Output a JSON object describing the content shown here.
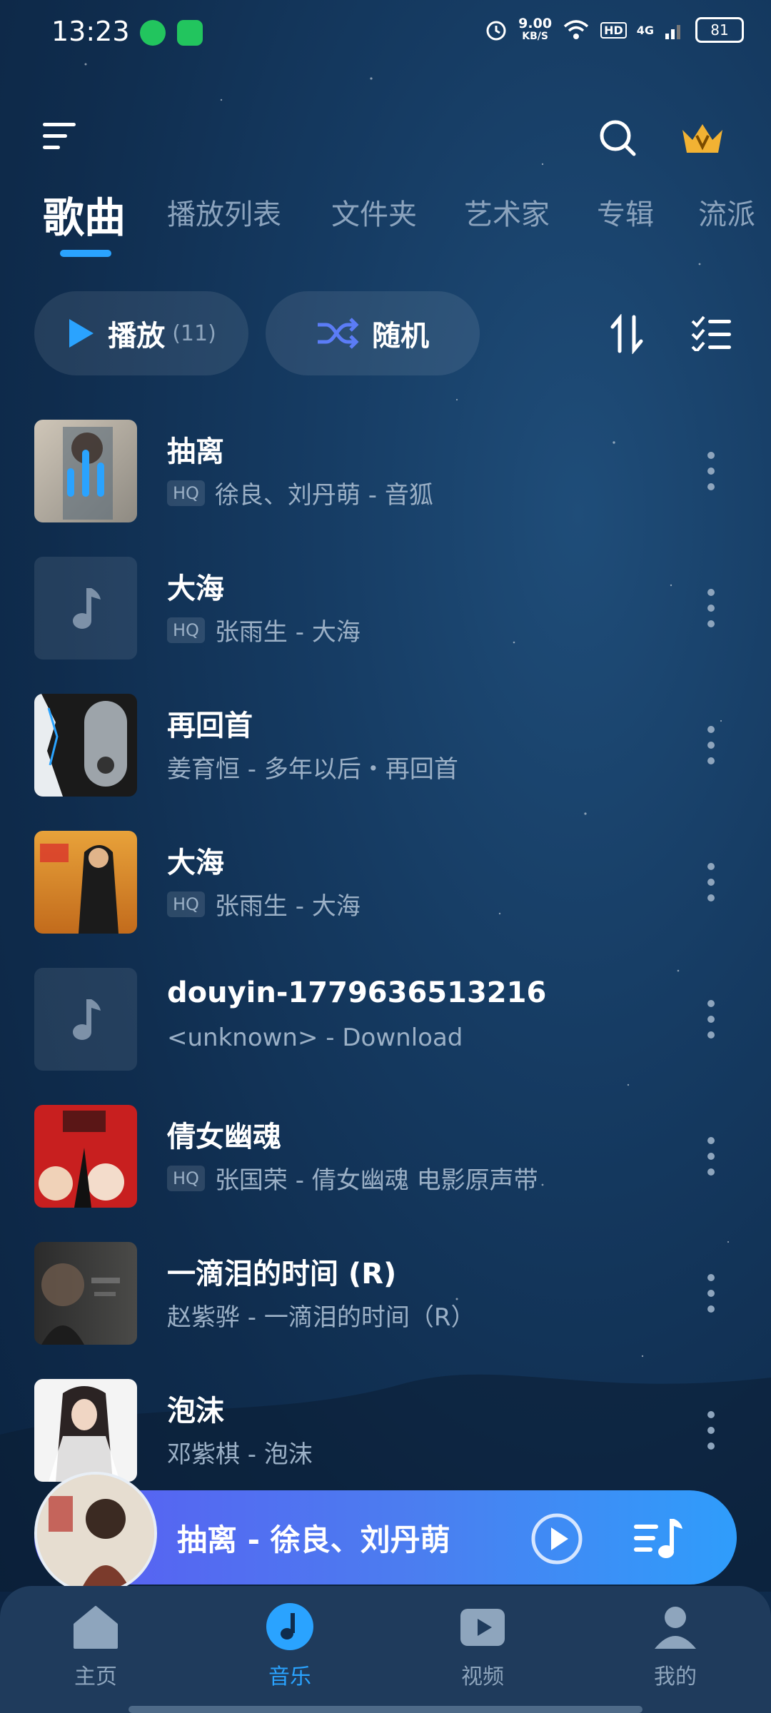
{
  "status_bar": {
    "time": "13:23",
    "net_speed_value": "9.00",
    "net_speed_unit": "KB/S",
    "hd": "HD",
    "net_type": "4G",
    "battery": "81"
  },
  "tabs": [
    "歌曲",
    "播放列表",
    "文件夹",
    "艺术家",
    "专辑",
    "流派"
  ],
  "controls": {
    "play_label": "播放",
    "play_count": "(11)",
    "shuffle_label": "随机"
  },
  "songs": [
    {
      "title": "抽离",
      "hq": "HQ",
      "subtitle": "徐良、刘丹萌 - 音狐"
    },
    {
      "title": "大海",
      "hq": "HQ",
      "subtitle": "张雨生 - 大海"
    },
    {
      "title": "再回首",
      "hq": "",
      "subtitle": "姜育恒 - 多年以后・再回首"
    },
    {
      "title": "大海",
      "hq": "HQ",
      "subtitle": "张雨生 - 大海"
    },
    {
      "title": "douyin-1779636513216",
      "hq": "",
      "subtitle": "<unknown> - Download"
    },
    {
      "title": "倩女幽魂",
      "hq": "HQ",
      "subtitle": "张国荣 - 倩女幽魂 电影原声带"
    },
    {
      "title": "一滴泪的时间 (R)",
      "hq": "",
      "subtitle": "赵紫骅 - 一滴泪的时间（R）"
    },
    {
      "title": "泡沫",
      "hq": "",
      "subtitle": "邓紫棋 - 泡沫"
    }
  ],
  "mini_player": {
    "title": "抽离 - 徐良、刘丹萌"
  },
  "bottom_nav": [
    {
      "label": "主页"
    },
    {
      "label": "音乐"
    },
    {
      "label": "视频"
    },
    {
      "label": "我的"
    }
  ],
  "colors": {
    "accent": "#2aa3ff",
    "background": "#153a61",
    "mini_player_start": "#5a5cf2",
    "mini_player_end": "#2f9dfb"
  }
}
